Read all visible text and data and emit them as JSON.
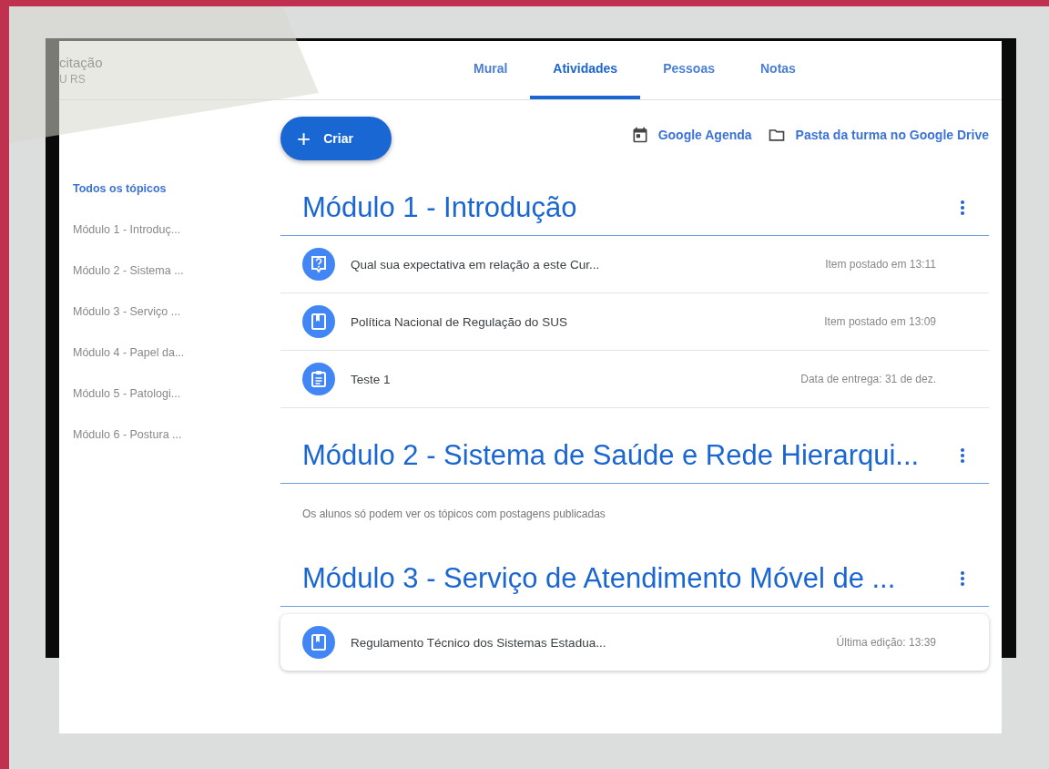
{
  "class_header": {
    "name": "citação",
    "section": "U RS"
  },
  "tabs": [
    {
      "label": "Mural",
      "selected": false
    },
    {
      "label": "Atividades",
      "selected": true
    },
    {
      "label": "Pessoas",
      "selected": false
    },
    {
      "label": "Notas",
      "selected": false
    }
  ],
  "create_button": {
    "icon": "+",
    "label": "Criar"
  },
  "links": [
    {
      "kind": "calendar",
      "label": "Google Agenda"
    },
    {
      "kind": "folder",
      "label": "Pasta da turma no Google Drive"
    }
  ],
  "topics_nav": [
    {
      "label": "Todos os tópicos",
      "selected": true
    },
    {
      "label": "Módulo 1 - Introduç...",
      "selected": false
    },
    {
      "label": "Módulo 2 - Sistema ...",
      "selected": false
    },
    {
      "label": "Módulo 3 - Serviço ...",
      "selected": false
    },
    {
      "label": "Módulo 4 - Papel da...",
      "selected": false
    },
    {
      "label": "Módulo 5 - Patologi...",
      "selected": false
    },
    {
      "label": "Módulo 6 - Postura ...",
      "selected": false
    }
  ],
  "topics": [
    {
      "title": "Módulo 1 - Introdução",
      "items": [
        {
          "kind": "question",
          "title": "Qual sua expectativa em relação a este Cur...",
          "meta": "Item postado em 13:11",
          "raised": false
        },
        {
          "kind": "material",
          "title": "Política Nacional de Regulação do SUS",
          "meta": "Item postado em 13:09",
          "raised": false
        },
        {
          "kind": "assignment",
          "title": "Teste 1",
          "meta": "Data de entrega: 31 de dez.",
          "raised": false
        }
      ]
    },
    {
      "title": "Módulo 2 - Sistema de Saúde e Rede Hierarqui...",
      "note": "Os alunos só podem ver os tópicos com postagens publicadas"
    },
    {
      "title": "Módulo 3 - Serviço de Atendimento Móvel de ...",
      "items": [
        {
          "kind": "material",
          "title": "Regulamento Técnico dos Sistemas Estadua...",
          "meta": "Última edição: 13:39",
          "raised": true
        }
      ]
    }
  ]
}
